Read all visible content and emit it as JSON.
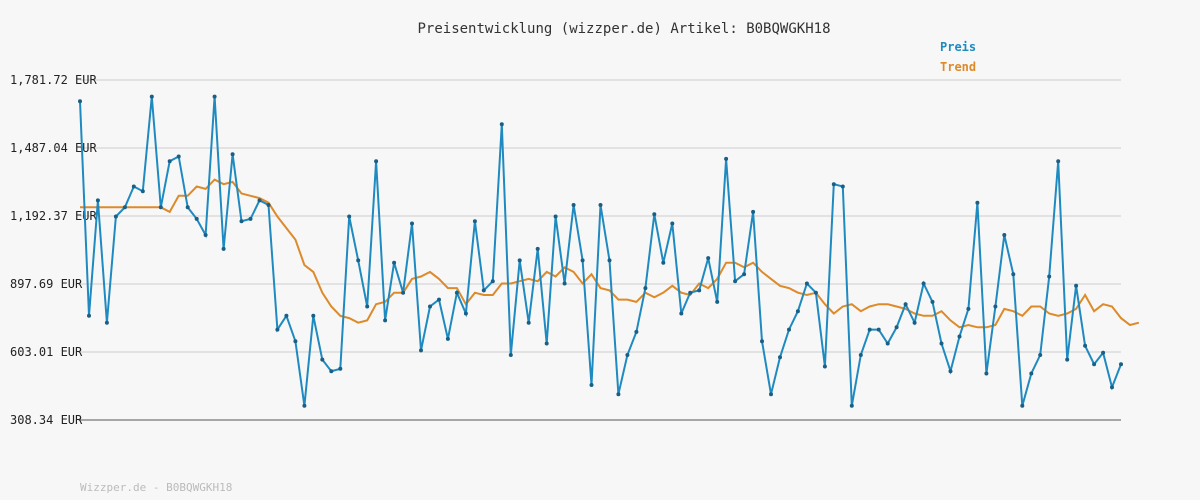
{
  "chart_data": {
    "type": "line",
    "title": "Preisentwicklung (wizzper.de) Artikel: B0BQWGKH18",
    "xlabel": "",
    "ylabel": "",
    "unit": "EUR",
    "ylim": [
      308.34,
      1781.72
    ],
    "y_ticks": [
      "1,781.72 EUR",
      "1,487.04 EUR",
      "1,192.37 EUR",
      "897.69 EUR",
      "603.01 EUR",
      "308.34 EUR"
    ],
    "grid": true,
    "legend_position": "top-right",
    "series": [
      {
        "name": "Preis",
        "color": "#1f8ac0",
        "values": [
          1690,
          760,
          1260,
          730,
          1190,
          1230,
          1320,
          1300,
          1710,
          1230,
          1430,
          1450,
          1230,
          1180,
          1110,
          1710,
          1050,
          1460,
          1170,
          1180,
          1260,
          1240,
          700,
          760,
          650,
          370,
          760,
          570,
          520,
          530,
          1190,
          1000,
          800,
          1430,
          740,
          990,
          860,
          1160,
          610,
          800,
          830,
          660,
          860,
          770,
          1170,
          870,
          910,
          1590,
          590,
          1000,
          730,
          1050,
          640,
          1190,
          900,
          1240,
          1000,
          460,
          1240,
          1000,
          420,
          590,
          690,
          880,
          1200,
          990,
          1160,
          770,
          860,
          870,
          1010,
          820,
          1440,
          910,
          940,
          1210,
          650,
          420,
          580,
          700,
          780,
          900,
          860,
          540,
          1330,
          1320,
          370,
          590,
          700,
          700,
          640,
          710,
          810,
          730,
          900,
          820,
          640,
          520,
          670,
          790,
          1250,
          510,
          800,
          1110,
          940,
          370,
          510,
          590,
          930,
          1430,
          570,
          890,
          630,
          550,
          600,
          450,
          550
        ],
        "trend_values": [
          1230,
          1230,
          1230,
          1230,
          1230,
          1230,
          1230,
          1230,
          1230,
          1230,
          1210,
          1280,
          1280,
          1320,
          1310,
          1350,
          1330,
          1340,
          1290,
          1280,
          1270,
          1250,
          1190,
          1140,
          1090,
          980,
          950,
          860,
          800,
          760,
          750,
          730,
          740,
          810,
          820,
          860,
          860,
          920,
          930,
          950,
          920,
          880,
          880,
          810,
          860,
          850,
          850,
          900,
          900,
          910,
          920,
          910,
          950,
          930,
          970,
          950,
          900,
          940,
          880,
          870,
          830,
          830,
          820,
          860,
          840,
          860,
          890,
          860,
          850,
          900,
          880,
          920,
          990,
          990,
          970,
          990,
          950,
          920,
          890,
          880,
          860,
          850,
          860,
          810,
          770,
          800,
          810,
          780,
          800,
          810,
          810,
          800,
          790,
          770,
          760,
          760,
          780,
          740,
          710,
          720,
          710,
          710,
          720,
          790,
          780,
          760,
          800,
          800,
          770,
          760,
          770,
          790,
          850,
          780,
          810,
          800,
          750,
          720,
          730
        ]
      }
    ],
    "trend_name": "Trend",
    "trend_color": "#dd8a2a"
  },
  "footer": "Wizzper.de - B0BQWGKH18"
}
